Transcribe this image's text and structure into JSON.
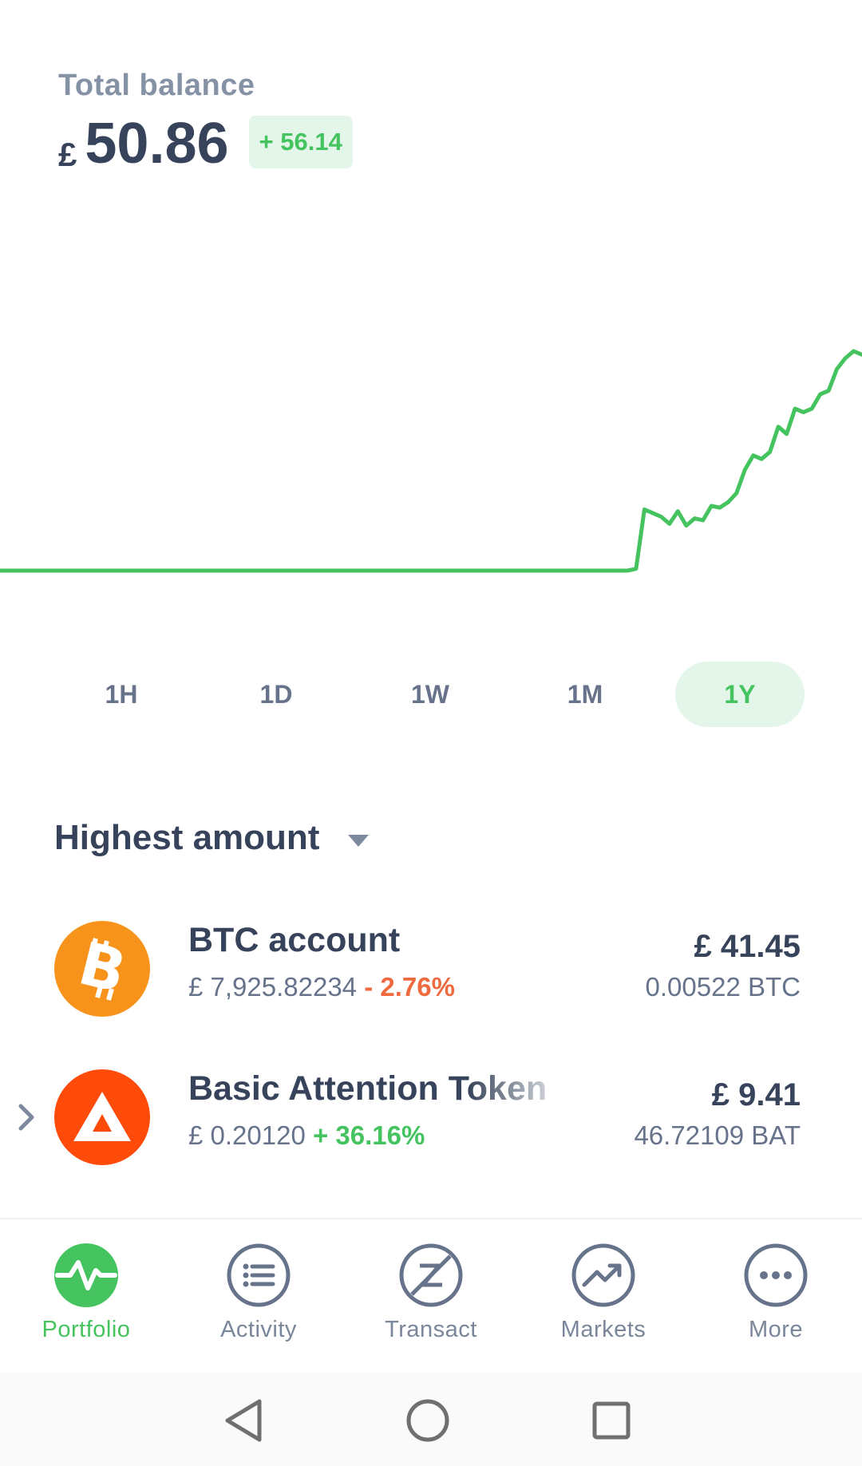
{
  "header": {
    "balance_label": "Total balance",
    "currency": "£",
    "balance": "50.86",
    "change": "+ 56.14"
  },
  "colors": {
    "accent_green": "#44c35f",
    "accent_green_bg": "#e3f6e9",
    "negative": "#ef6a3f",
    "text_dark": "#36435a",
    "text_muted": "#66738a",
    "btc_orange": "#f7931a",
    "bat_red": "#ff4b0a"
  },
  "ranges": {
    "options": [
      "1H",
      "1D",
      "1W",
      "1M",
      "1Y"
    ],
    "selected": "1Y"
  },
  "sort": {
    "label": "Highest amount"
  },
  "assets": [
    {
      "name": "BTC account",
      "price": "£ 7,925.82234",
      "change": "- 2.76%",
      "fiat": "£ 41.45",
      "amount": "0.00522 BTC",
      "icon": "bitcoin-icon"
    },
    {
      "name": "Basic Attention Token",
      "price": "£ 0.20120",
      "change": "+ 36.16%",
      "fiat": "£ 9.41",
      "amount": "46.72109 BAT",
      "icon": "bat-icon"
    }
  ],
  "nav": {
    "items": [
      {
        "label": "Portfolio",
        "icon": "pulse-icon"
      },
      {
        "label": "Activity",
        "icon": "list-icon"
      },
      {
        "label": "Transact",
        "icon": "transact-icon"
      },
      {
        "label": "Markets",
        "icon": "trend-icon"
      },
      {
        "label": "More",
        "icon": "more-icon"
      }
    ],
    "active": "Portfolio"
  },
  "system_nav": [
    "back-icon",
    "home-icon",
    "recents-icon"
  ],
  "chart_data": {
    "type": "line",
    "title": "",
    "xlabel": "",
    "ylabel": "",
    "grid": false,
    "series": [
      {
        "values": [
          0,
          0,
          0,
          0,
          0,
          0,
          0,
          0,
          0,
          0,
          0,
          0,
          0,
          0,
          0,
          0,
          0,
          0,
          0,
          0,
          0,
          0,
          0,
          0,
          0,
          0,
          0,
          0,
          0,
          0,
          0,
          0,
          0,
          0,
          0,
          0,
          0,
          0,
          0,
          0,
          0,
          0,
          0,
          0,
          0,
          0,
          0,
          0,
          0,
          0,
          0,
          0,
          0,
          0,
          0,
          0,
          0,
          0,
          0,
          0,
          0,
          0,
          0,
          0,
          0,
          0,
          0,
          0,
          0,
          0,
          0,
          0,
          0,
          0,
          0,
          0,
          0.5,
          17,
          16,
          15,
          13,
          16.5,
          12.5,
          14.5,
          14,
          18,
          17.5,
          19,
          21.5,
          28,
          32,
          31,
          33,
          40,
          38,
          45,
          44,
          45,
          49,
          50,
          56,
          59,
          61,
          60
        ]
      }
    ]
  }
}
